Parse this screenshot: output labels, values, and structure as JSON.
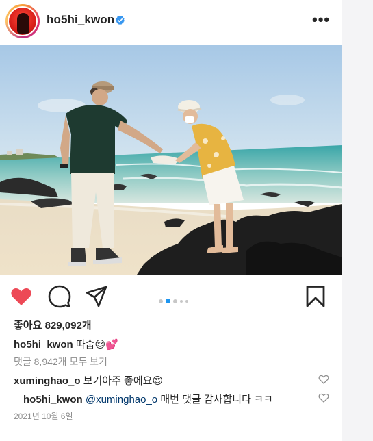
{
  "post": {
    "username": "ho5hi_kwon",
    "verified": true,
    "likes_text": "좋아요 829,092개",
    "caption_user": "ho5hi_kwon",
    "caption_text": "따숩",
    "caption_emojis": "😌💕",
    "view_comments": "댓글 8,942개 모두 보기",
    "date": "2021년 10월 6일",
    "liked": true,
    "carousel": {
      "count": 5,
      "active_index": 1
    }
  },
  "comments": [
    {
      "user": "xuminghao_o",
      "text": "보기아주 좋에요",
      "emoji": "😍"
    },
    {
      "user": "ho5hi_kwon",
      "mention": "@xuminghao_o",
      "text": "매번 댓글 감사합니다 ㅋㅋ"
    }
  ],
  "colors": {
    "like_red": "#ed4956",
    "verified_blue": "#3897f0",
    "carousel_active": "#1e96f0",
    "mention": "#00376b"
  },
  "icons": [
    "verified-icon",
    "more-icon",
    "heart-icon",
    "comment-icon",
    "share-icon",
    "bookmark-icon",
    "comment-like-icon"
  ]
}
